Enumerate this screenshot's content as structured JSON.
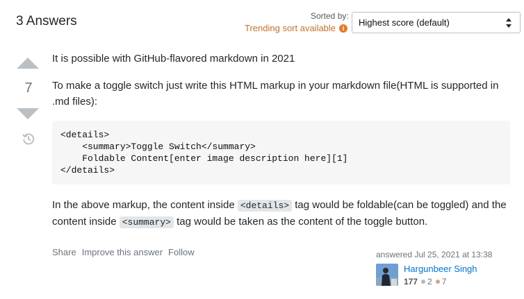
{
  "header": {
    "answers_title": "3 Answers",
    "sorted_by_label": "Sorted by:",
    "trending_text": "Trending sort available",
    "sort_select_value": "Highest score (default)"
  },
  "vote": {
    "count": "7"
  },
  "post": {
    "p1": "It is possible with GitHub-flavored markdown in 2021",
    "p2": "To make a toggle switch just write this HTML markup in your markdown file(HTML is supported in .md files):",
    "code": "<details>\n    <summary>Toggle Switch</summary>\n    Foldable Content[enter image description here][1]\n</details>",
    "p3_part1": "In the above markup, the content inside ",
    "p3_code1": "<details>",
    "p3_part2": " tag would be foldable(can be toggled) and the content inside ",
    "p3_code2": "<summary>",
    "p3_part3": " tag would be taken as the content of the toggle button."
  },
  "post_menu": {
    "share": "Share",
    "improve": "Improve this answer",
    "follow": "Follow"
  },
  "user": {
    "answered": "answered Jul 25, 2021 at 13:38",
    "name": "Hargunbeer Singh",
    "reputation": "177",
    "silver_badges": "2",
    "bronze_badges": "7"
  },
  "colors": {
    "trending": "#c2722e",
    "link": "#0074cc",
    "vote_arrow": "#bbc0c4",
    "silver": "#b4b8bc",
    "bronze": "#d1a684"
  },
  "icons": {
    "info": "info-icon",
    "history": "history-icon",
    "sort": "sort-arrows-icon"
  }
}
